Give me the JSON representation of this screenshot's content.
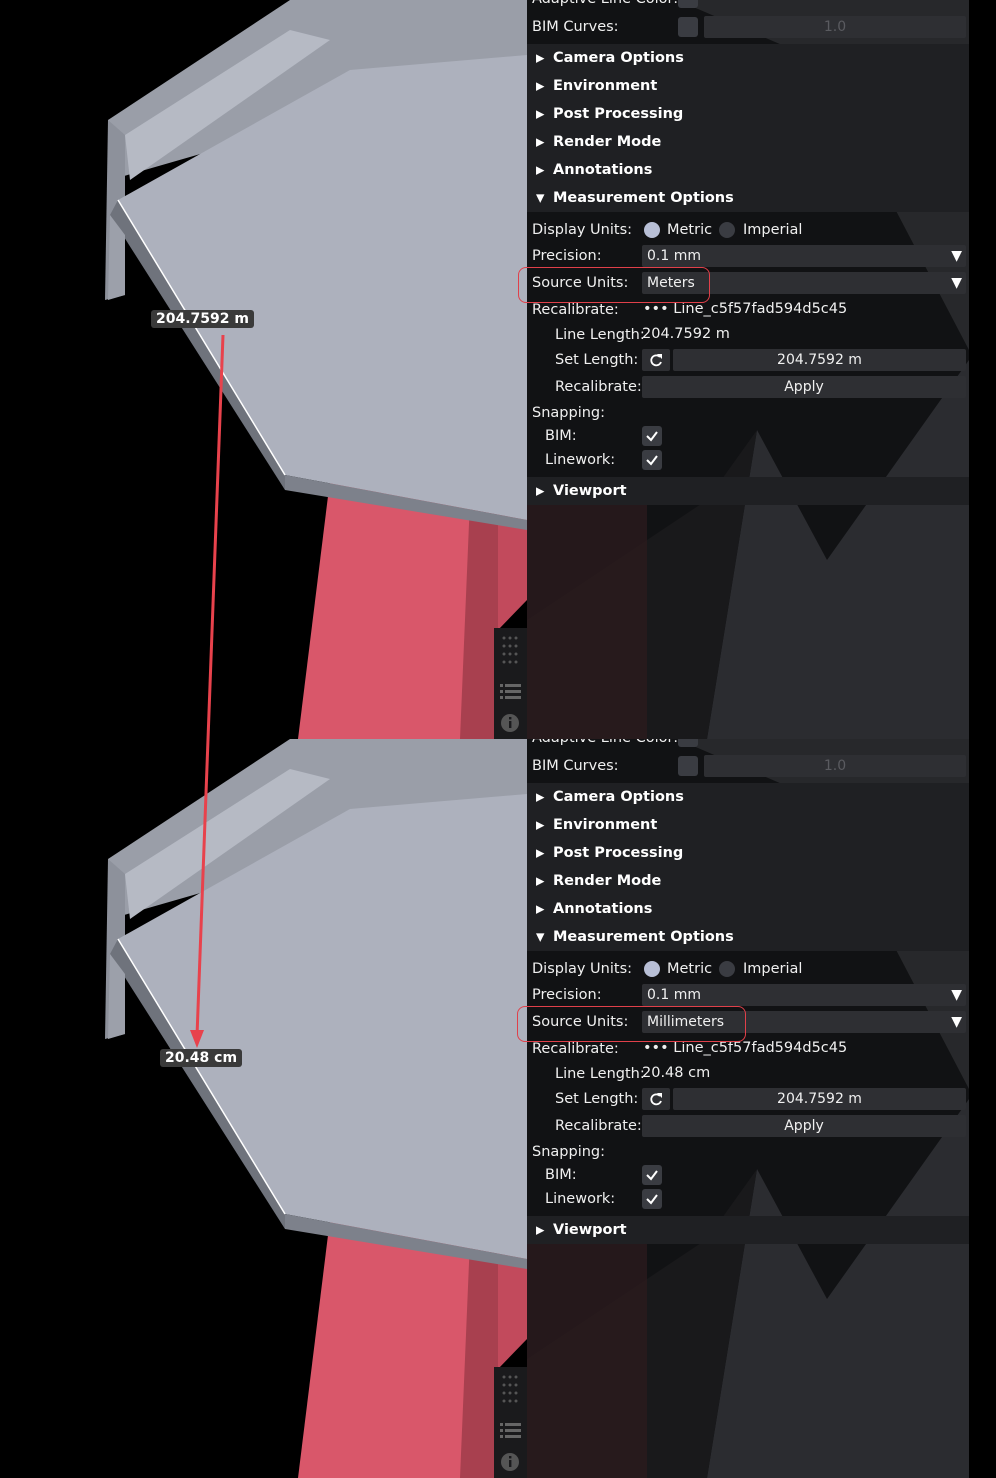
{
  "top": {
    "measure_label": "204.7592 m",
    "header": {
      "adaptive_line_color": "Adaptive Line Color:",
      "bim_curves": "BIM Curves:",
      "bim_curves_value": "1.0"
    },
    "sections": {
      "camera_options": "Camera Options",
      "environment": "Environment",
      "post_processing": "Post Processing",
      "render_mode": "Render Mode",
      "annotations": "Annotations",
      "measurement_options": "Measurement Options",
      "viewport": "Viewport"
    },
    "measurement": {
      "display_units_label": "Display Units:",
      "metric": "Metric",
      "imperial": "Imperial",
      "precision_label": "Precision:",
      "precision_value": "0.1 mm",
      "source_units_label": "Source Units:",
      "source_units_value": "Meters",
      "recalibrate_label": "Recalibrate:",
      "recalibrate_line": "••• Line_c5f57fad594d5c45",
      "line_length_label": "Line Length:",
      "line_length_value": "204.7592 m",
      "set_length_label": "Set Length:",
      "set_length_value": "204.7592 m",
      "recalibrate2_label": "Recalibrate:",
      "apply": "Apply",
      "snapping_label": "Snapping:",
      "bim_label": "BIM:",
      "linework_label": "Linework:"
    }
  },
  "bottom": {
    "measure_label": "20.48 cm",
    "header": {
      "adaptive_line_color": "Adaptive Line Color:",
      "bim_curves": "BIM Curves:",
      "bim_curves_value": "1.0"
    },
    "sections": {
      "camera_options": "Camera Options",
      "environment": "Environment",
      "post_processing": "Post Processing",
      "render_mode": "Render Mode",
      "annotations": "Annotations",
      "measurement_options": "Measurement Options",
      "viewport": "Viewport"
    },
    "measurement": {
      "display_units_label": "Display Units:",
      "metric": "Metric",
      "imperial": "Imperial",
      "precision_label": "Precision:",
      "precision_value": "0.1 mm",
      "source_units_label": "Source Units:",
      "source_units_value": "Millimeters",
      "recalibrate_label": "Recalibrate:",
      "recalibrate_line": "••• Line_c5f57fad594d5c45",
      "line_length_label": "Line Length:",
      "line_length_value": "20.48 cm",
      "set_length_label": "Set Length:",
      "set_length_value": "204.7592 m",
      "recalibrate2_label": "Recalibrate:",
      "apply": "Apply",
      "snapping_label": "Snapping:",
      "bim_label": "BIM:",
      "linework_label": "Linework:"
    }
  },
  "icons": [
    "triangle-right-icon",
    "triangle-down-icon",
    "dropdown-arrow-icon",
    "refresh-icon",
    "checkmark-icon",
    "drag-grip-icon",
    "list-icon",
    "info-icon"
  ],
  "colors": {
    "highlight": "#e0404a",
    "annotation_arrow": "#e8424c",
    "model_red": "#d9576a",
    "model_gray": "#a9adb8",
    "model_purple": "#6a2a9a"
  }
}
